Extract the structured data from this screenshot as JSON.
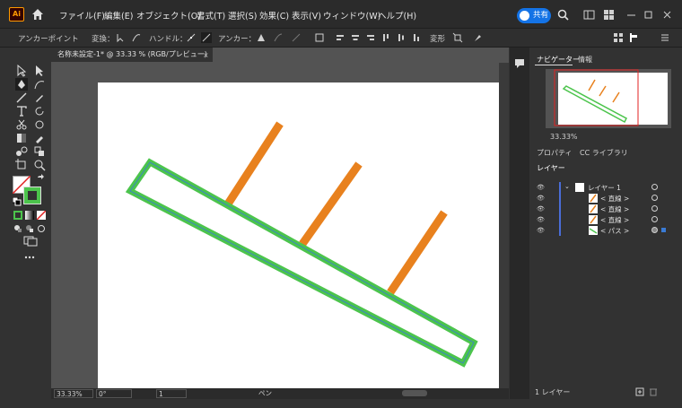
{
  "menubar": {
    "logo": "Ai",
    "items": [
      "ファイル(F)",
      "編集(E)",
      "オブジェクト(O)",
      "書式(T)",
      "選択(S)",
      "効果(C)",
      "表示(V)",
      "ウィンドウ(W)",
      "ヘルプ(H)"
    ],
    "share_label": "共有"
  },
  "controlbar": {
    "mode_label": "アンカーポイント",
    "convert_label": "変換：",
    "handle_label": "ハンドル：",
    "anchor_label": "アンカー：",
    "transform_label": "変形"
  },
  "document": {
    "tab_title": "名称未設定-1* @ 33.33 % (RGB/プレビュー)",
    "tab_close": "×"
  },
  "statusbar": {
    "zoom": "33.33%",
    "rotation": "0°",
    "artboard": "1",
    "tool_name": "ペン"
  },
  "navigator": {
    "tab_navigator": "ナビゲーター",
    "tab_info": "情報",
    "zoom": "33.33%"
  },
  "properties": {
    "tab_properties": "プロパティ",
    "tab_libraries": "CC ライブラリ"
  },
  "layers": {
    "tab_label": "レイヤー",
    "rows": [
      {
        "name": "レイヤー 1"
      },
      {
        "name": "< 直線 >"
      },
      {
        "name": "< 直線 >"
      },
      {
        "name": "< 直線 >"
      },
      {
        "name": "< パス >"
      }
    ],
    "footer": "1 レイヤー"
  },
  "colors": {
    "orange_line": "#e8811e",
    "green_path": "#4cc44c",
    "accent": "#1473e6",
    "layer_bar": "#4a6dd8"
  }
}
